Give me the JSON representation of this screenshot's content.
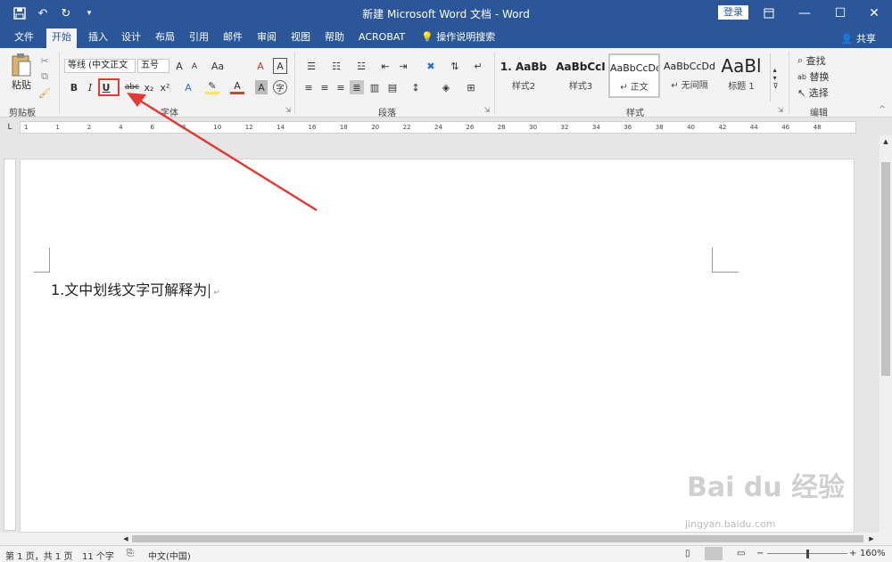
{
  "window": {
    "title": "新建 Microsoft Word 文档 - Word",
    "login_label": "登录"
  },
  "tabs": [
    "文件",
    "开始",
    "插入",
    "设计",
    "布局",
    "引用",
    "邮件",
    "审阅",
    "视图",
    "帮助",
    "ACROBAT"
  ],
  "search_tab": "操作说明搜索",
  "share_label": "共享",
  "clipboard": {
    "paste_label": "粘贴",
    "group_label": "剪贴板"
  },
  "font": {
    "name": "等线 (中文正文",
    "size": "五号",
    "group_label": "字体",
    "bold": "B",
    "italic": "I",
    "underline": "U",
    "strike": "abc",
    "subscript": "x₂",
    "superscript": "x²",
    "grow": "A",
    "shrink": "A",
    "change_case": "Aa",
    "clear": "A",
    "font_color": "A",
    "char_shade": "A",
    "enclose": "字"
  },
  "paragraph": {
    "group_label": "段落"
  },
  "styles": {
    "group_label": "样式",
    "items": [
      {
        "sample": "1. AaBb",
        "name": "样式2"
      },
      {
        "sample": "AaBbCcI",
        "name": "样式3"
      },
      {
        "sample": "AaBbCcDd",
        "name": "↵ 正文"
      },
      {
        "sample": "AaBbCcDd",
        "name": "↵ 无间隔"
      },
      {
        "sample": "AaBl",
        "name": "标题 1"
      }
    ]
  },
  "editing": {
    "group_label": "编辑",
    "find": "查找",
    "replace": "替换",
    "select": "选择"
  },
  "ruler": {
    "numbers": [
      "1",
      "1",
      "2",
      "4",
      "6",
      "8",
      "10",
      "12",
      "14",
      "16",
      "18",
      "20",
      "22",
      "24",
      "26",
      "28",
      "30",
      "32",
      "34",
      "36",
      "38",
      "40",
      "42",
      "44",
      "46",
      "48"
    ]
  },
  "document": {
    "text": "1.文中划线文字可解释为",
    "para_mark": "↵"
  },
  "statusbar": {
    "page": "第 1 页，共 1 页",
    "words": "11 个字",
    "language": "中文(中国)",
    "zoom": "160%"
  },
  "watermark": {
    "brand": "Bai du 经验",
    "url": "jingyan.baidu.com"
  },
  "colors": {
    "accent": "#2b579a",
    "annotation": "#e53935"
  }
}
